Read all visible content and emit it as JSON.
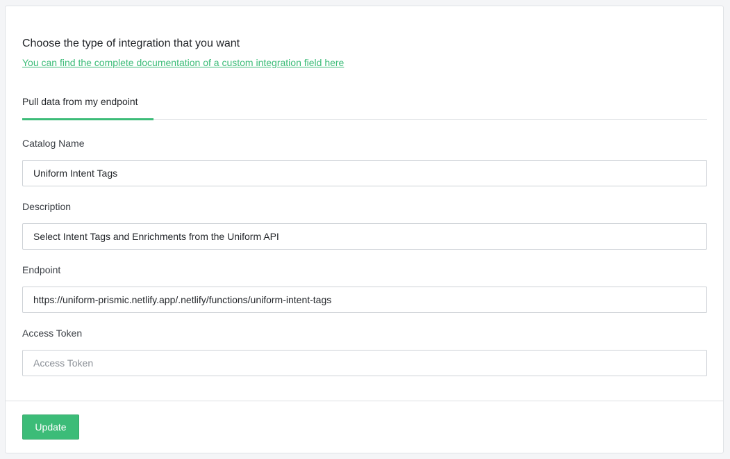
{
  "header": {
    "title": "Choose the type of integration that you want",
    "doc_link": "You can find the complete documentation of a custom integration field here"
  },
  "tabs": [
    {
      "label": "Pull data from my endpoint",
      "active": true
    }
  ],
  "form": {
    "catalog_name": {
      "label": "Catalog Name",
      "value": "Uniform Intent Tags"
    },
    "description": {
      "label": "Description",
      "value": "Select Intent Tags and Enrichments from the Uniform API"
    },
    "endpoint": {
      "label": "Endpoint",
      "value": "https://uniform-prismic.netlify.app/.netlify/functions/uniform-intent-tags"
    },
    "access_token": {
      "label": "Access Token",
      "value": "",
      "placeholder": "Access Token"
    }
  },
  "footer": {
    "update_label": "Update"
  },
  "colors": {
    "accent": "#3cbc78",
    "border": "#cdd1d6",
    "background": "#f4f5f7"
  }
}
